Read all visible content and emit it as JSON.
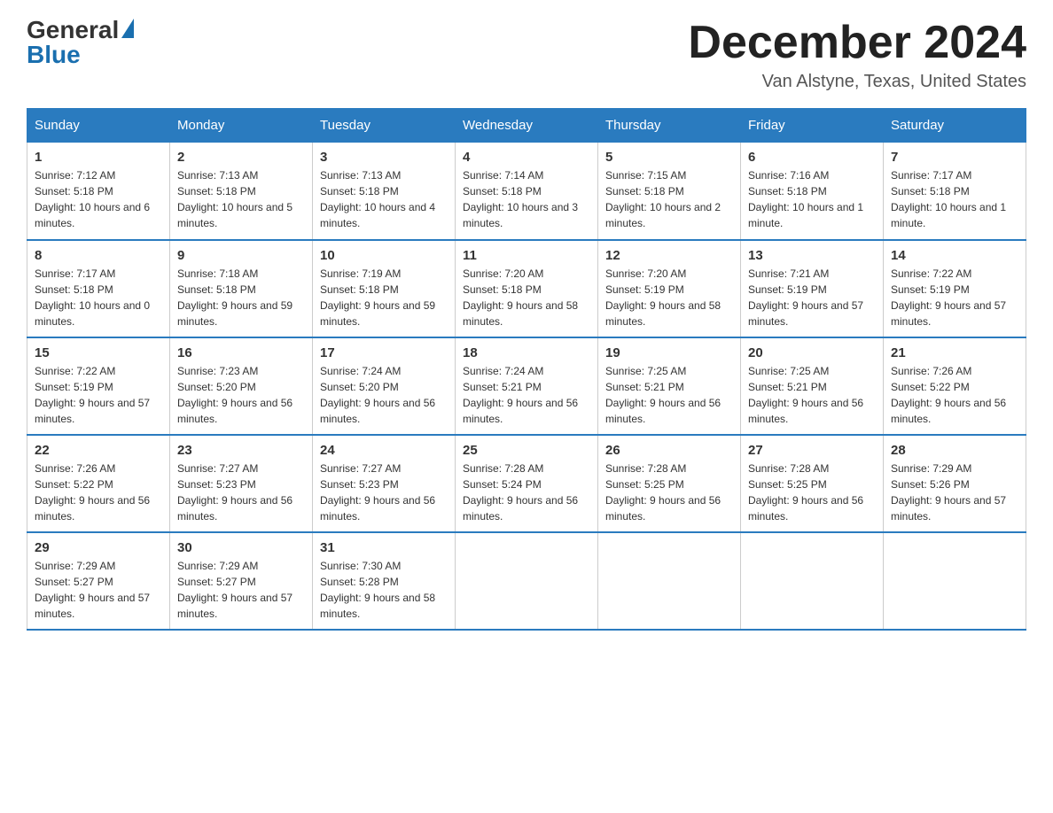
{
  "header": {
    "logo_general": "General",
    "logo_blue": "Blue",
    "month_title": "December 2024",
    "location": "Van Alstyne, Texas, United States"
  },
  "days_of_week": [
    "Sunday",
    "Monday",
    "Tuesday",
    "Wednesday",
    "Thursday",
    "Friday",
    "Saturday"
  ],
  "weeks": [
    [
      {
        "day": "1",
        "sunrise": "7:12 AM",
        "sunset": "5:18 PM",
        "daylight": "10 hours and 6 minutes."
      },
      {
        "day": "2",
        "sunrise": "7:13 AM",
        "sunset": "5:18 PM",
        "daylight": "10 hours and 5 minutes."
      },
      {
        "day": "3",
        "sunrise": "7:13 AM",
        "sunset": "5:18 PM",
        "daylight": "10 hours and 4 minutes."
      },
      {
        "day": "4",
        "sunrise": "7:14 AM",
        "sunset": "5:18 PM",
        "daylight": "10 hours and 3 minutes."
      },
      {
        "day": "5",
        "sunrise": "7:15 AM",
        "sunset": "5:18 PM",
        "daylight": "10 hours and 2 minutes."
      },
      {
        "day": "6",
        "sunrise": "7:16 AM",
        "sunset": "5:18 PM",
        "daylight": "10 hours and 1 minute."
      },
      {
        "day": "7",
        "sunrise": "7:17 AM",
        "sunset": "5:18 PM",
        "daylight": "10 hours and 1 minute."
      }
    ],
    [
      {
        "day": "8",
        "sunrise": "7:17 AM",
        "sunset": "5:18 PM",
        "daylight": "10 hours and 0 minutes."
      },
      {
        "day": "9",
        "sunrise": "7:18 AM",
        "sunset": "5:18 PM",
        "daylight": "9 hours and 59 minutes."
      },
      {
        "day": "10",
        "sunrise": "7:19 AM",
        "sunset": "5:18 PM",
        "daylight": "9 hours and 59 minutes."
      },
      {
        "day": "11",
        "sunrise": "7:20 AM",
        "sunset": "5:18 PM",
        "daylight": "9 hours and 58 minutes."
      },
      {
        "day": "12",
        "sunrise": "7:20 AM",
        "sunset": "5:19 PM",
        "daylight": "9 hours and 58 minutes."
      },
      {
        "day": "13",
        "sunrise": "7:21 AM",
        "sunset": "5:19 PM",
        "daylight": "9 hours and 57 minutes."
      },
      {
        "day": "14",
        "sunrise": "7:22 AM",
        "sunset": "5:19 PM",
        "daylight": "9 hours and 57 minutes."
      }
    ],
    [
      {
        "day": "15",
        "sunrise": "7:22 AM",
        "sunset": "5:19 PM",
        "daylight": "9 hours and 57 minutes."
      },
      {
        "day": "16",
        "sunrise": "7:23 AM",
        "sunset": "5:20 PM",
        "daylight": "9 hours and 56 minutes."
      },
      {
        "day": "17",
        "sunrise": "7:24 AM",
        "sunset": "5:20 PM",
        "daylight": "9 hours and 56 minutes."
      },
      {
        "day": "18",
        "sunrise": "7:24 AM",
        "sunset": "5:21 PM",
        "daylight": "9 hours and 56 minutes."
      },
      {
        "day": "19",
        "sunrise": "7:25 AM",
        "sunset": "5:21 PM",
        "daylight": "9 hours and 56 minutes."
      },
      {
        "day": "20",
        "sunrise": "7:25 AM",
        "sunset": "5:21 PM",
        "daylight": "9 hours and 56 minutes."
      },
      {
        "day": "21",
        "sunrise": "7:26 AM",
        "sunset": "5:22 PM",
        "daylight": "9 hours and 56 minutes."
      }
    ],
    [
      {
        "day": "22",
        "sunrise": "7:26 AM",
        "sunset": "5:22 PM",
        "daylight": "9 hours and 56 minutes."
      },
      {
        "day": "23",
        "sunrise": "7:27 AM",
        "sunset": "5:23 PM",
        "daylight": "9 hours and 56 minutes."
      },
      {
        "day": "24",
        "sunrise": "7:27 AM",
        "sunset": "5:23 PM",
        "daylight": "9 hours and 56 minutes."
      },
      {
        "day": "25",
        "sunrise": "7:28 AM",
        "sunset": "5:24 PM",
        "daylight": "9 hours and 56 minutes."
      },
      {
        "day": "26",
        "sunrise": "7:28 AM",
        "sunset": "5:25 PM",
        "daylight": "9 hours and 56 minutes."
      },
      {
        "day": "27",
        "sunrise": "7:28 AM",
        "sunset": "5:25 PM",
        "daylight": "9 hours and 56 minutes."
      },
      {
        "day": "28",
        "sunrise": "7:29 AM",
        "sunset": "5:26 PM",
        "daylight": "9 hours and 57 minutes."
      }
    ],
    [
      {
        "day": "29",
        "sunrise": "7:29 AM",
        "sunset": "5:27 PM",
        "daylight": "9 hours and 57 minutes."
      },
      {
        "day": "30",
        "sunrise": "7:29 AM",
        "sunset": "5:27 PM",
        "daylight": "9 hours and 57 minutes."
      },
      {
        "day": "31",
        "sunrise": "7:30 AM",
        "sunset": "5:28 PM",
        "daylight": "9 hours and 58 minutes."
      },
      null,
      null,
      null,
      null
    ]
  ]
}
